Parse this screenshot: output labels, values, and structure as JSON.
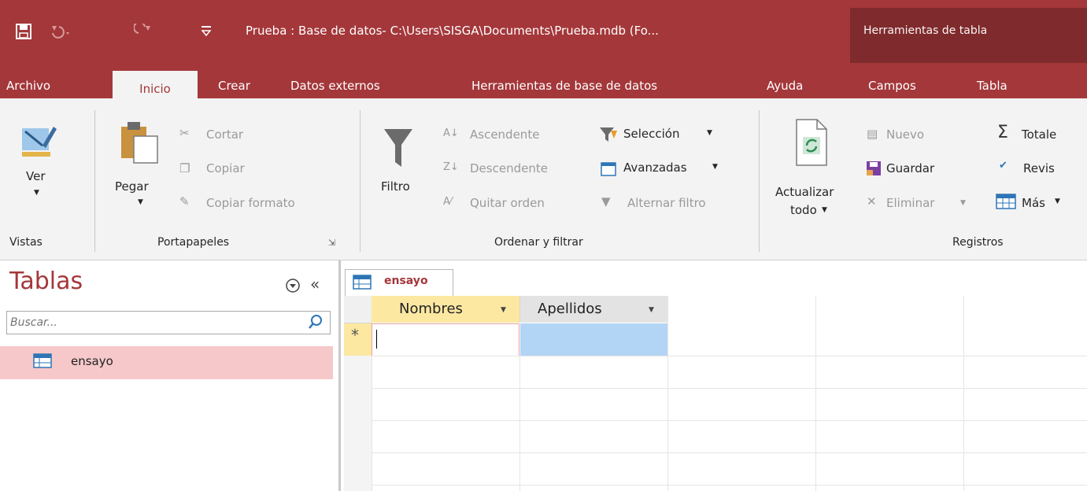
{
  "title_bar": {
    "title": "Prueba : Base de datos- C:\\Users\\SISGA\\Documents\\Prueba.mdb (Fo...",
    "context_label": "Herramientas de tabla"
  },
  "tabs": [
    "Archivo",
    "Inicio",
    "Crear",
    "Datos externos",
    "Herramientas de base de datos",
    "Ayuda",
    "Campos",
    "Tabla"
  ],
  "ribbon": {
    "ver": "Ver",
    "pegar": "Pegar",
    "cortar": "Cortar",
    "copiar": "Copiar",
    "copiar_formato": "Copiar formato",
    "filtro": "Filtro",
    "ascendente": "Ascendente",
    "descendente": "Descendente",
    "quitar_orden": "Quitar orden",
    "seleccion": "Selección",
    "avanzadas": "Avanzadas",
    "alternar_filtro": "Alternar filtro",
    "actualizar": "Actualizar",
    "todo": "todo",
    "nuevo": "Nuevo",
    "guardar": "Guardar",
    "eliminar": "Eliminar",
    "totales": "Totale",
    "revisar": "Revis",
    "mas": "Más",
    "groups": {
      "vistas": "Vistas",
      "portapapeles": "Portapapeles",
      "ordenar": "Ordenar y filtrar",
      "registros": "Registros"
    }
  },
  "nav": {
    "title": "Tablas",
    "search_placeholder": "Buscar...",
    "items": [
      "ensayo"
    ]
  },
  "datasheet": {
    "tab_label": "ensayo",
    "columns": [
      "Nombres",
      "Apellidos"
    ],
    "new_row_marker": "*"
  },
  "colors": {
    "accent": "#a4373a",
    "context_tab": "#7f2a2c",
    "selected_item": "#f6c8c9",
    "column_header_active": "#fde8a2",
    "cell_selected": "#b3d5f5"
  }
}
